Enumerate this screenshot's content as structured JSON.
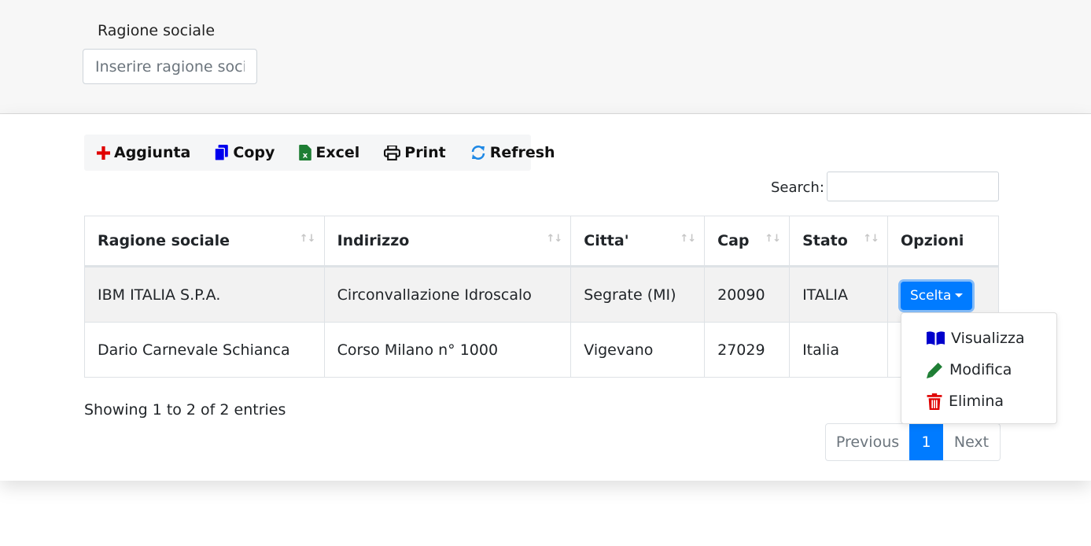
{
  "filter": {
    "label": "Ragione sociale",
    "placeholder": "Inserire ragione social"
  },
  "toolbar": {
    "buttons": [
      {
        "label": "Aggiunta",
        "icon": "plus-icon",
        "color": "#e00000"
      },
      {
        "label": "Copy",
        "icon": "copy-icon",
        "color": "#0000ee"
      },
      {
        "label": "Excel",
        "icon": "excel-icon",
        "color": "#1e7e34"
      },
      {
        "label": "Print",
        "icon": "print-icon",
        "color": "#111111"
      },
      {
        "label": "Refresh",
        "icon": "refresh-icon",
        "color": "#1e88e5"
      }
    ]
  },
  "search": {
    "label": "Search:",
    "value": ""
  },
  "table": {
    "columns": [
      "Ragione sociale",
      "Indirizzo",
      "Citta'",
      "Cap",
      "Stato",
      "Opzioni"
    ],
    "rows": [
      [
        "IBM ITALIA S.P.A.",
        "Circonvallazione Idroscalo",
        "Segrate (MI)",
        "20090",
        "ITALIA"
      ],
      [
        "Dario Carnevale Schianca",
        "Corso Milano n° 1000",
        "Vigevano",
        "27029",
        "Italia"
      ]
    ],
    "options_button": "Scelta"
  },
  "dropdown": {
    "items": [
      {
        "label": "Visualizza",
        "icon": "book-icon",
        "color": "#0000cc"
      },
      {
        "label": "Modifica",
        "icon": "pencil-icon",
        "color": "#1e7e34"
      },
      {
        "label": "Elimina",
        "icon": "trash-icon",
        "color": "#e00000"
      }
    ]
  },
  "info": "Showing 1 to 2 of 2 entries",
  "pagination": {
    "previous": "Previous",
    "current": "1",
    "next": "Next"
  },
  "colors": {
    "primary": "#007bff",
    "panel_bg": "#f7f7f7",
    "stripe": "#f2f2f2"
  }
}
